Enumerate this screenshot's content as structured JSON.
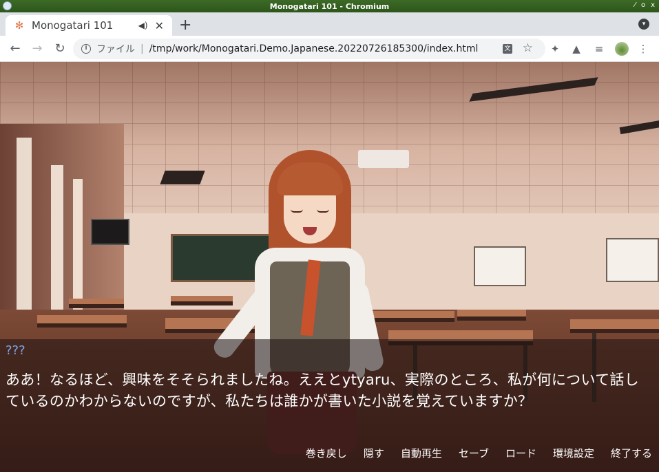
{
  "window": {
    "title": "Monogatari 101 - Chromium"
  },
  "browser": {
    "tab": {
      "title": "Monogatari 101",
      "favicon": "flower-icon",
      "audio": "speaker-icon",
      "close": "✕"
    },
    "new_tab": "+",
    "nav": {
      "back": "←",
      "forward": "→",
      "reload": "↻"
    },
    "omnibox": {
      "scheme_label": "ファイル",
      "separator": "|",
      "url": "/tmp/work/Monogatari.Demo.Japanese.20220726185300/index.html"
    },
    "icons": [
      "translate-icon",
      "star-icon",
      "extensions-icon",
      "flask-icon",
      "media-icon",
      "profile-avatar",
      "menu-icon"
    ]
  },
  "game": {
    "speaker": "???",
    "dialogue": "ああ！なるほど、興味をそそられましたね。ええとytyaru、実際のところ、私が何について話しているのかわからないのですが、私たちは誰かが書いた小説を覚えていますか？",
    "quick_menu": [
      {
        "label": "巻き戻し"
      },
      {
        "label": "隠す"
      },
      {
        "label": "自動再生"
      },
      {
        "label": "セーブ"
      },
      {
        "label": "ロード"
      },
      {
        "label": "環境設定"
      },
      {
        "label": "終了する"
      }
    ],
    "colors": {
      "speaker": "#7da6e8",
      "text": "#ffffff",
      "dialogue_bg": "rgba(30,18,18,0.55)"
    }
  }
}
